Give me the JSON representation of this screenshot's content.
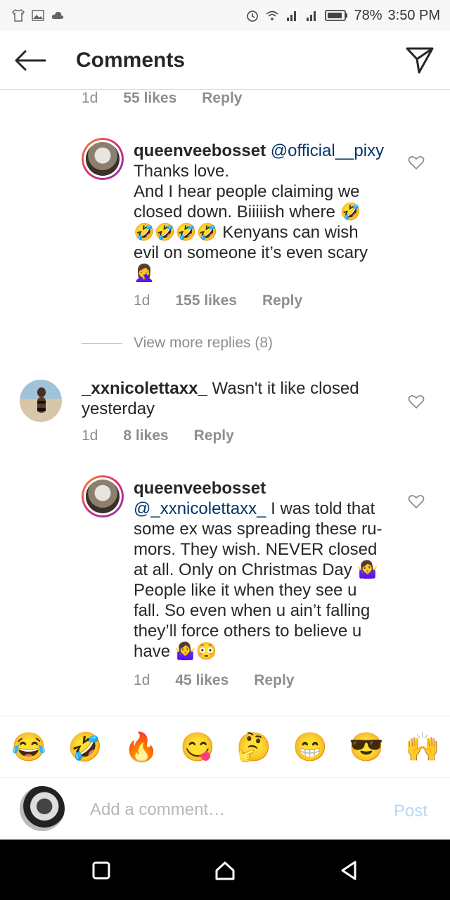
{
  "status_bar": {
    "battery": "78%",
    "time": "3:50 PM"
  },
  "header": {
    "title": "Comments"
  },
  "top_meta": {
    "age": "1d",
    "likes": "55 likes",
    "reply": "Reply"
  },
  "reply1": {
    "username": "queenveebosset",
    "mention": "@official__pixy",
    "lines": [
      "Thanks love.",
      "And I hear people claiming we",
      "closed down. Biiiiish where 🤣",
      "🤣🤣🤣🤣 Kenyans can wish",
      "evil on someone it’s even scary",
      "🤦‍♀️"
    ],
    "age": "1d",
    "likes": "155 likes",
    "reply": "Reply"
  },
  "view_more": "View more replies (8)",
  "comment2": {
    "username": "_xxnicolettaxx_",
    "text_first": "Wasn't it like closed",
    "text_second": "yesterday",
    "age": "1d",
    "likes": "8 likes",
    "reply": "Reply"
  },
  "reply2": {
    "username": "queenveebosset",
    "mention": "@_xxnicolettaxx_",
    "lines_after_mention": "I was told that",
    "lines": [
      "some ex was spreading these ru-",
      "mors. They wish. NEVER closed",
      "at all. Only on Christmas Day 🤷‍♀️",
      "People like it when they see u",
      "fall. So even when u ain’t falling",
      "they’ll force others to believe u",
      "have 🤷‍♀️😳"
    ],
    "age": "1d",
    "likes": "45 likes",
    "reply": "Reply"
  },
  "emoji_bar": [
    "😂",
    "🤣",
    "🔥",
    "😋",
    "🤔",
    "😁",
    "😎",
    "🙌"
  ],
  "composer": {
    "placeholder": "Add a comment…",
    "post": "Post"
  },
  "colors": {
    "link": "#003569",
    "muted": "#8e8e8e",
    "post_disabled": "#b3d7f7"
  }
}
